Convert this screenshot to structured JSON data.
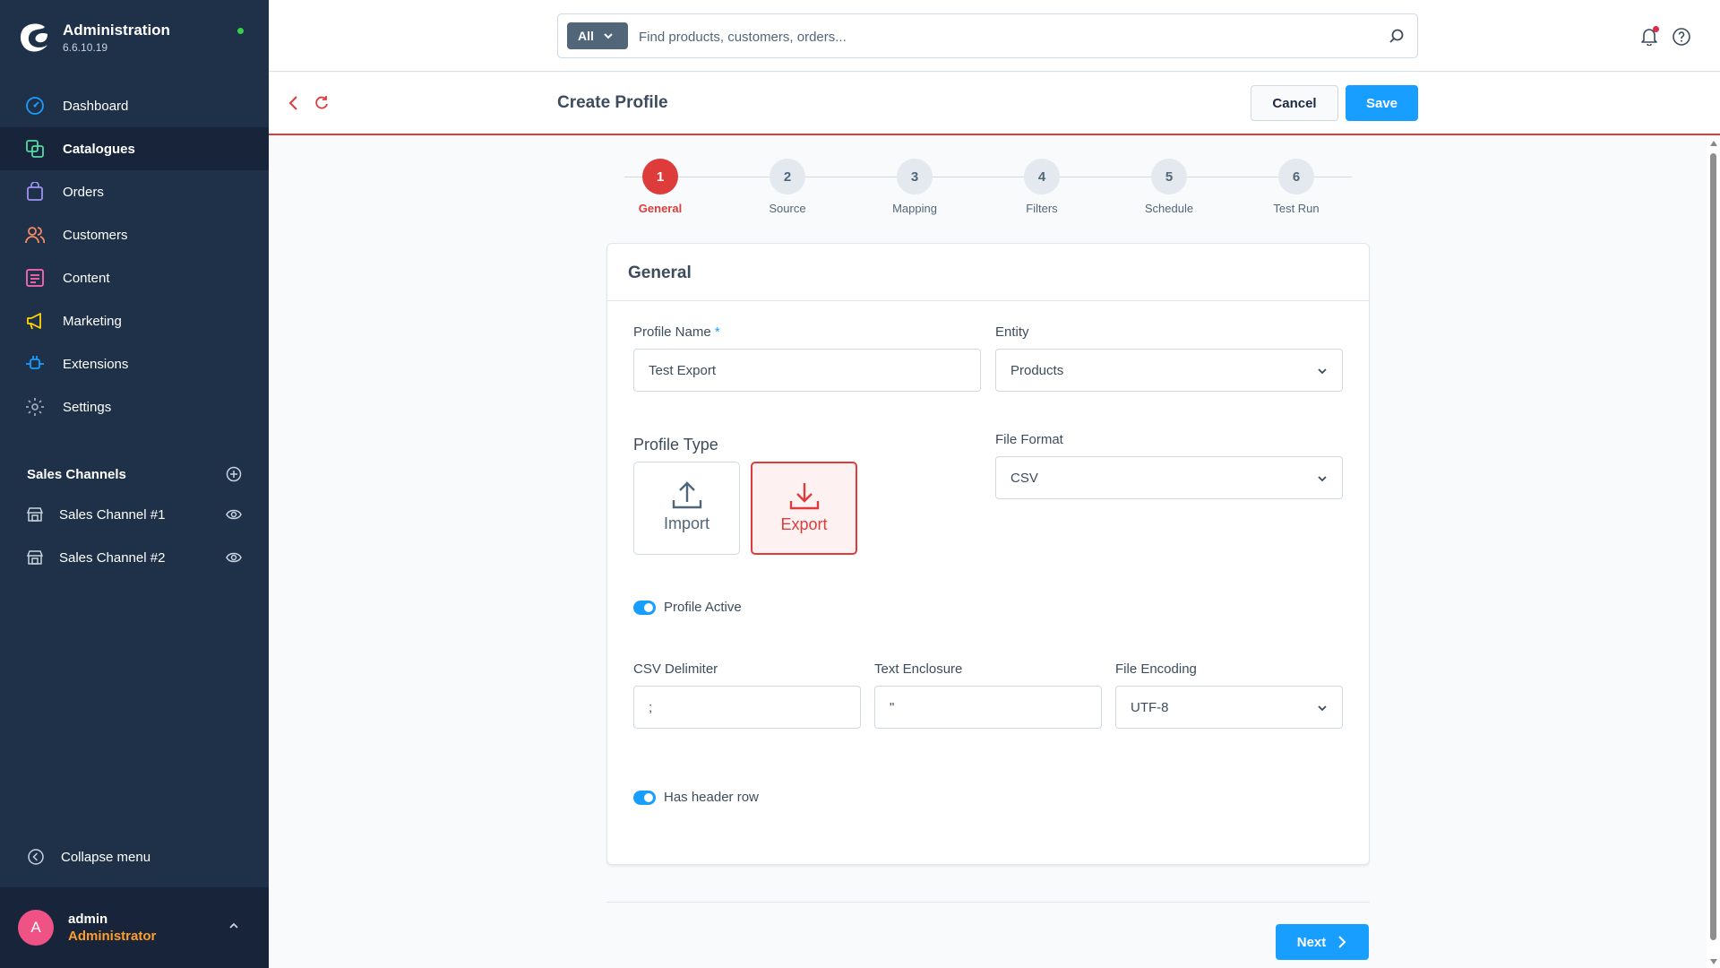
{
  "app": {
    "title": "Administration",
    "version": "6.6.10.19",
    "colors": {
      "sidebar": "#1f3049",
      "accent": "#189eff",
      "active_step": "#de3b3b",
      "status_online": "#37d046"
    }
  },
  "sidebar": {
    "items": [
      {
        "label": "Dashboard",
        "icon": "dashboard-icon",
        "icon_color": "#189eff"
      },
      {
        "label": "Catalogues",
        "icon": "catalogue-icon",
        "icon_color": "#57d9a3",
        "active": true
      },
      {
        "label": "Orders",
        "icon": "shopping-bag-icon",
        "icon_color": "#a092f0"
      },
      {
        "label": "Customers",
        "icon": "customers-icon",
        "icon_color": "#f88962"
      },
      {
        "label": "Content",
        "icon": "content-icon",
        "icon_color": "#ff68b4"
      },
      {
        "label": "Marketing",
        "icon": "megaphone-icon",
        "icon_color": "#ffd700"
      },
      {
        "label": "Extensions",
        "icon": "plug-icon",
        "icon_color": "#189eff"
      },
      {
        "label": "Settings",
        "icon": "gear-icon",
        "icon_color": "#9aa8b5"
      }
    ],
    "sales_channels": {
      "title": "Sales Channels",
      "items": [
        {
          "label": "Sales Channel #1"
        },
        {
          "label": "Sales Channel #2"
        }
      ]
    },
    "collapse_label": "Collapse menu",
    "user": {
      "initial": "A",
      "name": "admin",
      "role": "Administrator"
    }
  },
  "topbar": {
    "search_type": "All",
    "search_placeholder": "Find products, customers, orders..."
  },
  "smartbar": {
    "title": "Create Profile",
    "cancel_label": "Cancel",
    "save_label": "Save"
  },
  "stepper": {
    "steps": [
      {
        "number": "1",
        "label": "General",
        "active": true
      },
      {
        "number": "2",
        "label": "Source"
      },
      {
        "number": "3",
        "label": "Mapping"
      },
      {
        "number": "4",
        "label": "Filters"
      },
      {
        "number": "5",
        "label": "Schedule"
      },
      {
        "number": "6",
        "label": "Test Run"
      }
    ]
  },
  "form": {
    "card_title": "General",
    "profile_name": {
      "label": "Profile Name",
      "required": "*",
      "value": "Test Export"
    },
    "entity": {
      "label": "Entity",
      "value": "Products"
    },
    "profile_type": {
      "label": "Profile Type",
      "import_label": "Import",
      "export_label": "Export",
      "selected": "Export"
    },
    "file_format": {
      "label": "File Format",
      "value": "CSV"
    },
    "profile_active": {
      "label": "Profile Active",
      "checked": true
    },
    "csv_delimiter": {
      "label": "CSV Delimiter",
      "value": ";"
    },
    "text_enclosure": {
      "label": "Text Enclosure",
      "value": "\""
    },
    "file_encoding": {
      "label": "File Encoding",
      "value": "UTF-8"
    },
    "has_header_row": {
      "label": "Has header row",
      "checked": true
    }
  },
  "footer": {
    "next_label": "Next"
  }
}
